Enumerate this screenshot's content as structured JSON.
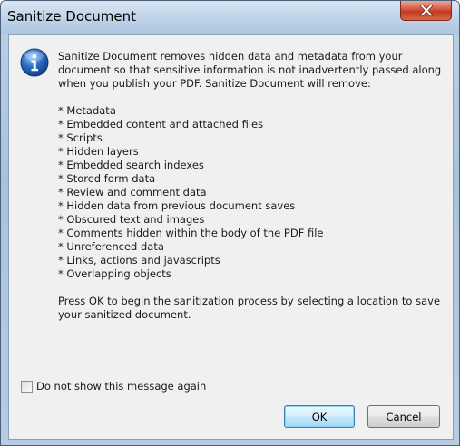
{
  "window": {
    "title": "Sanitize Document",
    "close_icon": "close-icon"
  },
  "message": {
    "icon": "info-icon",
    "intro": "Sanitize Document removes hidden data and metadata from your document so that sensitive information is not inadvertently passed along when you publish your PDF. Sanitize Document will remove:",
    "items": [
      "* Metadata",
      "* Embedded content and attached files",
      "* Scripts",
      "* Hidden layers",
      "* Embedded search indexes",
      "* Stored form data",
      "* Review and comment data",
      "* Hidden data from previous document saves",
      "* Obscured text and images",
      "* Comments hidden within the body of the PDF file",
      "* Unreferenced data",
      "* Links, actions and javascripts",
      "* Overlapping objects"
    ],
    "outro": "Press OK to begin the sanitization process by selecting a location to save your sanitized document."
  },
  "checkbox": {
    "label": "Do not show this message again",
    "checked": false
  },
  "buttons": {
    "ok": "OK",
    "cancel": "Cancel"
  },
  "colors": {
    "accent_blue": "#3c7fb1",
    "close_red": "#c23a1f",
    "info_icon_blue": "#2a6bc2"
  }
}
